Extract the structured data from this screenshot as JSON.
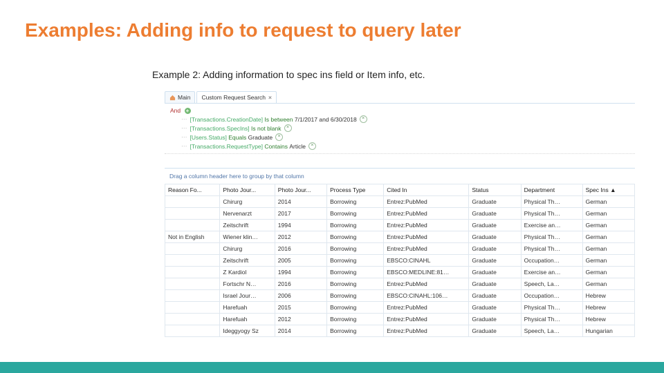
{
  "title": "Examples: Adding info to request to query later",
  "subtitle": "Example 2: Adding information to spec ins field or Item info, etc.",
  "tabs": {
    "main": "Main",
    "custom": "Custom Request Search"
  },
  "filter": {
    "and": "And",
    "line1": {
      "bracket": "[Transactions.CreationDate]",
      "op": "Is between",
      "val": "7/1/2017 and 6/30/2018"
    },
    "line2": {
      "bracket": "[Transactions.SpecIns]",
      "op": "Is not blank"
    },
    "line3": {
      "bracket": "[Users.Status]",
      "op": "Equals",
      "val": "Graduate"
    },
    "line4": {
      "bracket": "[Transactions.RequestType]",
      "op": "Contains",
      "val": "Article"
    }
  },
  "grouper": "Drag a column header here to group by that column",
  "cols": [
    "Reason Fo...",
    "Photo Jour...",
    "Photo Jour...",
    "Process Type",
    "Cited In",
    "Status",
    "Department",
    "Spec Ins   ▲"
  ],
  "rows": [
    [
      "",
      "Chirurg",
      "2014",
      "Borrowing",
      "Entrez:PubMed",
      "Graduate",
      "Physical Th…",
      "German"
    ],
    [
      "",
      "Nervenarzt",
      "2017",
      "Borrowing",
      "Entrez:PubMed",
      "Graduate",
      "Physical Th…",
      "German"
    ],
    [
      "",
      "Zeitschrift",
      "1994",
      "Borrowing",
      "Entrez:PubMed",
      "Graduate",
      "Exercise an…",
      "German"
    ],
    [
      "Not in English",
      "Wiener klin…",
      "2012",
      "Borrowing",
      "Entrez:PubMed",
      "Graduate",
      "Physical Th…",
      "German"
    ],
    [
      "",
      "Chirurg",
      "2016",
      "Borrowing",
      "Entrez:PubMed",
      "Graduate",
      "Physical Th…",
      "German"
    ],
    [
      "",
      "Zeitschrift",
      "2005",
      "Borrowing",
      "EBSCO:CINAHL",
      "Graduate",
      "Occupation…",
      "German"
    ],
    [
      "",
      "Z Kardiol",
      "1994",
      "Borrowing",
      "EBSCO:MEDLINE:81…",
      "Graduate",
      "Exercise an…",
      "German"
    ],
    [
      "",
      "Fortschr N…",
      "2016",
      "Borrowing",
      "Entrez:PubMed",
      "Graduate",
      "Speech, La…",
      "German"
    ],
    [
      "",
      "Israel Jour…",
      "2006",
      "Borrowing",
      "EBSCO:CINAHL:106…",
      "Graduate",
      "Occupation…",
      "Hebrew"
    ],
    [
      "",
      "Harefuah",
      "2015",
      "Borrowing",
      "Entrez:PubMed",
      "Graduate",
      "Physical Th…",
      "Hebrew"
    ],
    [
      "",
      "Harefuah",
      "2012",
      "Borrowing",
      "Entrez:PubMed",
      "Graduate",
      "Physical Th…",
      "Hebrew"
    ],
    [
      "",
      "Ideggyogy Sz",
      "2014",
      "Borrowing",
      "Entrez:PubMed",
      "Graduate",
      "Speech, La…",
      "Hungarian"
    ]
  ]
}
